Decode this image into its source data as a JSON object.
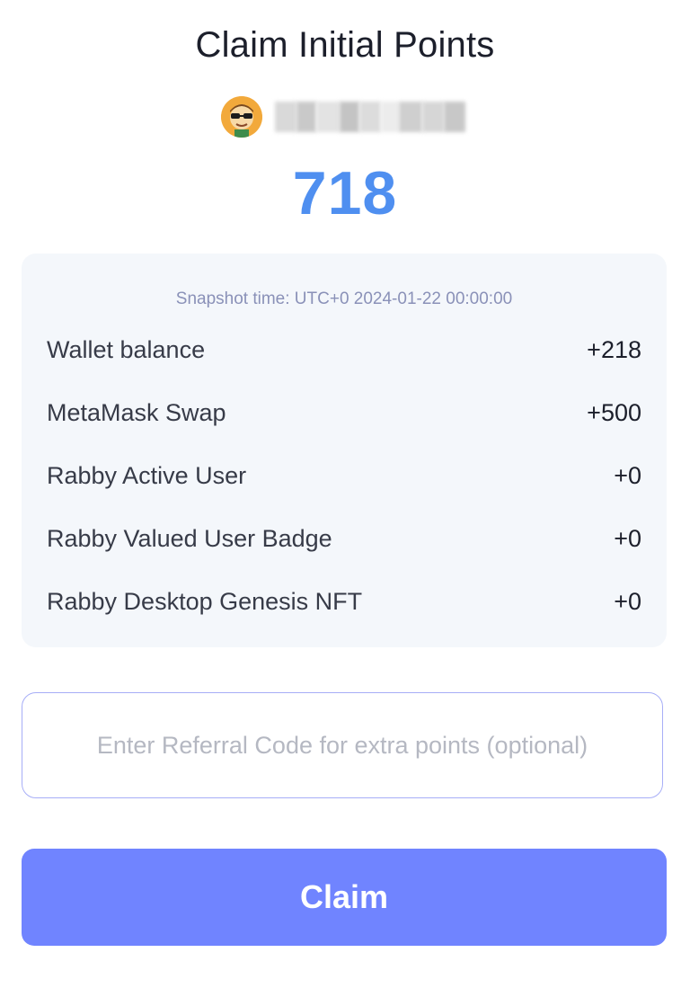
{
  "header": {
    "title": "Claim Initial Points"
  },
  "user": {
    "avatar_icon": "sunglasses-avatar-icon"
  },
  "points": {
    "total": "718",
    "accent_color": "#4f8ff0"
  },
  "breakdown": {
    "snapshot": "Snapshot time: UTC+0 2024-01-22 00:00:00",
    "items": [
      {
        "label": "Wallet balance",
        "value": "+218"
      },
      {
        "label": "MetaMask Swap",
        "value": "+500"
      },
      {
        "label": "Rabby Active User",
        "value": "+0"
      },
      {
        "label": "Rabby Valued User Badge",
        "value": "+0"
      },
      {
        "label": "Rabby Desktop Genesis NFT",
        "value": "+0"
      }
    ]
  },
  "referral": {
    "value": "",
    "placeholder": "Enter Referral Code for extra points (optional)"
  },
  "actions": {
    "claim_label": "Claim",
    "claim_color": "#7084ff"
  }
}
